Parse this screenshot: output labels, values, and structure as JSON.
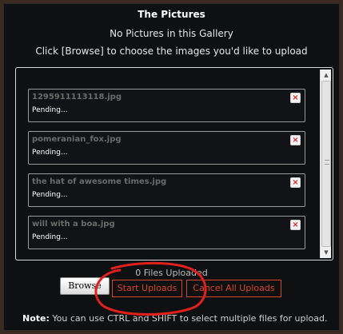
{
  "dialog": {
    "title": "The Pictures",
    "subtitle": "No Pictures in this Gallery",
    "hint": "Click [Browse] to choose the images you'd like to upload"
  },
  "queue": {
    "items": [
      {
        "filename": "1295911113118.jpg",
        "status": "Pending...",
        "remove_icon": "×"
      },
      {
        "filename": "pomeranian_fox.jpg",
        "status": "Pending...",
        "remove_icon": "×"
      },
      {
        "filename": "the hat of awesome times.jpg",
        "status": "Pending...",
        "remove_icon": "×"
      },
      {
        "filename": "will with a boa.jpg",
        "status": "Pending...",
        "remove_icon": "×"
      }
    ],
    "scroll_up": "▲",
    "scroll_down": "▼"
  },
  "footer": {
    "uploaded_count": "0 Files Uploaded",
    "browse_label": "Browse",
    "start_label": "Start Uploads",
    "cancel_label": "Cancel All Uploads",
    "note_label": "Note:",
    "note_text": " You can use CTRL and SHIFT to select multiple files for upload."
  },
  "colors": {
    "background": "#0f1012",
    "accent": "#d9442c",
    "annotation": "#e0201c"
  }
}
